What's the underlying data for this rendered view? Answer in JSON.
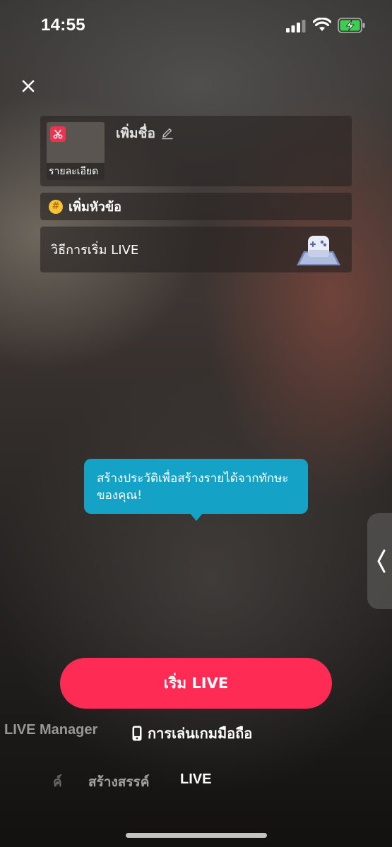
{
  "status_bar": {
    "time": "14:55",
    "icons": [
      "cellular-signal-icon",
      "wifi-icon",
      "battery-charging-icon"
    ]
  },
  "close_icon": "close-icon",
  "live_setup": {
    "cover": {
      "caption": "รายละเอียด",
      "edit_icon": "scissors-icon"
    },
    "title_placeholder": "เพิ่มชื่อ",
    "title_edit_icon": "pencil-icon",
    "topic": {
      "icon": "hashtag-icon",
      "label": "เพิ่มหัวข้อ"
    },
    "how_to": {
      "label": "วิธีการเริ่ม LIVE",
      "illustration": "game-controller-icon"
    }
  },
  "tooltip": {
    "text": "สร้างประวัติเพื่อสร้างรายได้จากทักษะของคุณ!"
  },
  "side_panel": {
    "icon": "chevron-left-icon"
  },
  "go_live_button": {
    "label": "เริ่ม LIVE",
    "color": "#fe2c55"
  },
  "live_modes": [
    {
      "label": "LIVE Manager"
    },
    {
      "label": "การเล่นเกมมือถือ",
      "icon": "phone-icon"
    }
  ],
  "bottom_nav": {
    "partial": "ค์",
    "create": "สร้างสรรค์",
    "live": "LIVE"
  },
  "colors": {
    "accent": "#fe2c55",
    "tooltip": "#14a3c7",
    "topic_icon": "#f7c23a",
    "scissors_badge": "#f0324f"
  }
}
